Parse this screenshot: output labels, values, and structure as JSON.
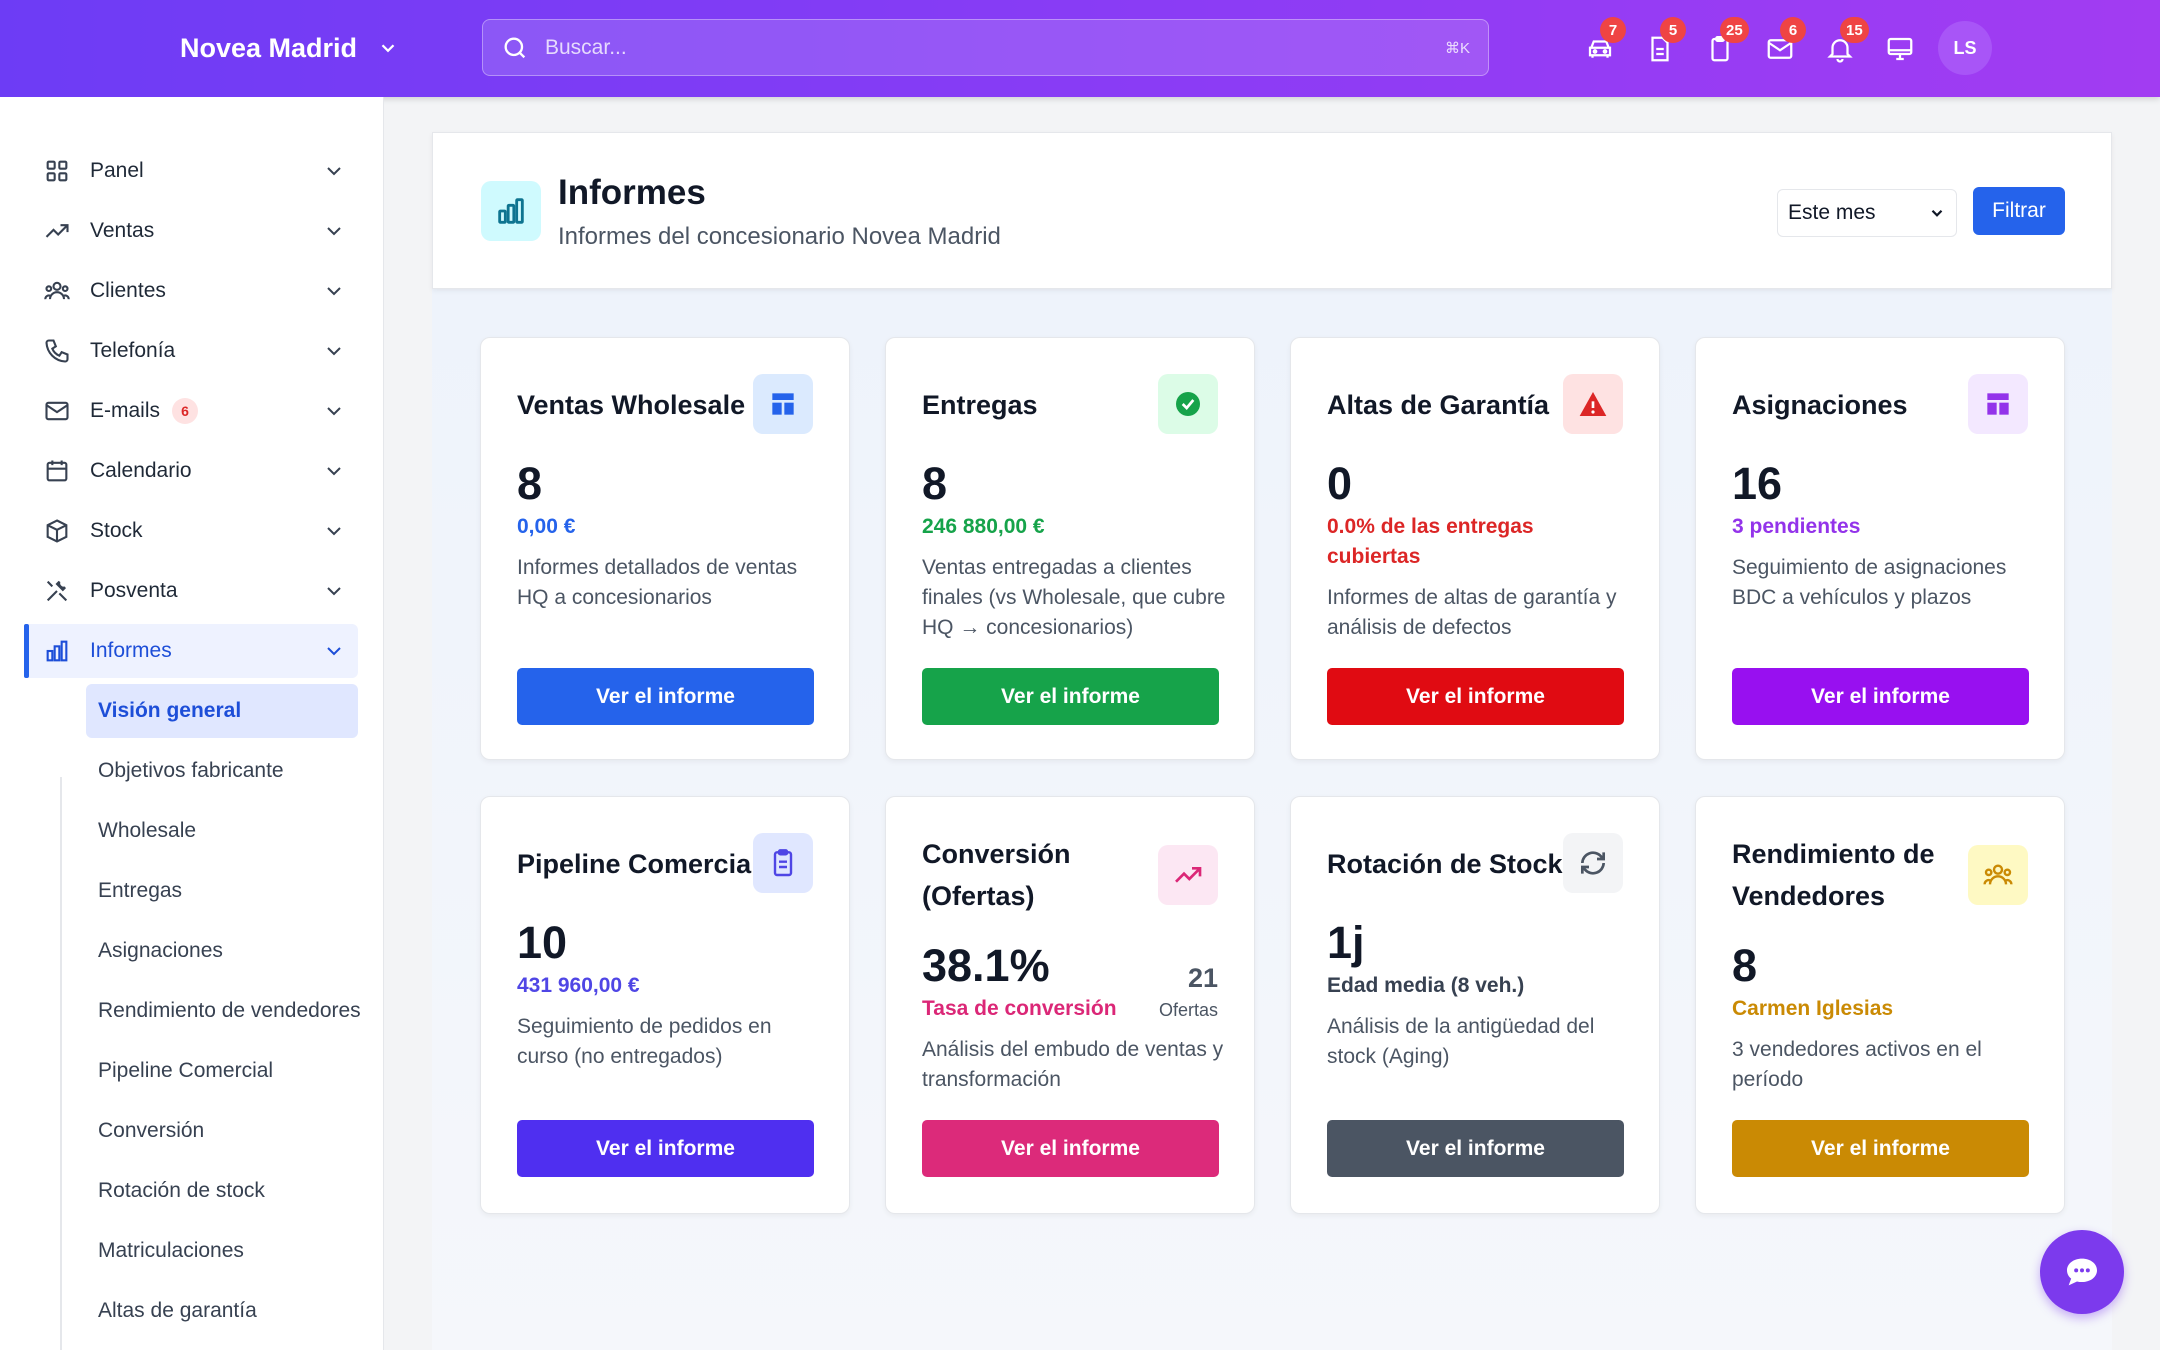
{
  "topbar": {
    "brand": "Novea Madrid",
    "search_placeholder": "Buscar...",
    "search_shortcut": "⌘K",
    "icons": [
      {
        "name": "car-icon",
        "count": "7"
      },
      {
        "name": "document-icon",
        "count": "5"
      },
      {
        "name": "clipboard-icon",
        "count": "25"
      },
      {
        "name": "mail-icon",
        "count": "6"
      },
      {
        "name": "bell-icon",
        "count": "15"
      },
      {
        "name": "monitor-icon",
        "count": ""
      }
    ],
    "avatar": "LS"
  },
  "sidebar": {
    "items": [
      {
        "label": "Panel",
        "icon": "grid-icon"
      },
      {
        "label": "Ventas",
        "icon": "trend-up-icon"
      },
      {
        "label": "Clientes",
        "icon": "users-icon"
      },
      {
        "label": "Telefonía",
        "icon": "phone-icon"
      },
      {
        "label": "E-mails",
        "icon": "mail-icon",
        "badge": "6"
      },
      {
        "label": "Calendario",
        "icon": "calendar-icon"
      },
      {
        "label": "Stock",
        "icon": "box-icon"
      },
      {
        "label": "Posventa",
        "icon": "tools-icon"
      },
      {
        "label": "Informes",
        "icon": "bar-chart-icon",
        "active": true
      }
    ],
    "subitems": [
      {
        "label": "Visión general",
        "active": true
      },
      {
        "label": "Objetivos fabricante"
      },
      {
        "label": "Wholesale"
      },
      {
        "label": "Entregas"
      },
      {
        "label": "Asignaciones"
      },
      {
        "label": "Rendimiento de vendedores"
      },
      {
        "label": "Pipeline Comercial"
      },
      {
        "label": "Conversión"
      },
      {
        "label": "Rotación de stock"
      },
      {
        "label": "Matriculaciones"
      },
      {
        "label": "Altas de garantía"
      }
    ]
  },
  "header": {
    "title": "Informes",
    "subtitle": "Informes del concesionario Novea Madrid",
    "period": "Este mes",
    "filter_label": "Filtrar"
  },
  "cards": [
    {
      "title": "Ventas Wholesale",
      "icon": "layout-icon",
      "value": "8",
      "sub": "0,00 €",
      "sub_color": "#2563eb",
      "desc": "Informes detallados de ventas HQ a concesionarios",
      "button": "Ver el informe",
      "color": "#2563eb",
      "icon_bg": "#dbeafe"
    },
    {
      "title": "Entregas",
      "icon": "check-circle-icon",
      "value": "8",
      "sub": "246 880,00 €",
      "sub_color": "#16a34a",
      "desc": "Ventas entregadas a clientes finales (vs Wholesale, que cubre HQ → concesionarios)",
      "button": "Ver el informe",
      "color": "#16a34a",
      "icon_bg": "#dcfce7"
    },
    {
      "title": "Altas de Garantía",
      "icon": "warning-icon",
      "value": "0",
      "sub": "0.0% de las entregas cubiertas",
      "sub_color": "#dc2626",
      "desc": "Informes de altas de garantía y análisis de defectos",
      "button": "Ver el informe",
      "color": "#e00b12",
      "icon_bg": "#fee2e2"
    },
    {
      "title": "Asignaciones",
      "icon": "layout-icon",
      "value": "16",
      "sub": "3 pendientes",
      "sub_color": "#9333ea",
      "desc": "Seguimiento de asignaciones BDC a vehículos y plazos",
      "button": "Ver el informe",
      "color": "#9810f0",
      "icon_bg": "#f3e8ff"
    },
    {
      "title": "Pipeline Comercial",
      "icon": "clipboard-list-icon",
      "value": "10",
      "sub": "431 960,00 €",
      "sub_color": "#4f46e5",
      "desc": "Seguimiento de pedidos en curso (no entregados)",
      "button": "Ver el informe",
      "color": "#4f2ff0",
      "icon_bg": "#e0e7ff"
    },
    {
      "title": "Conversión (Ofertas)",
      "icon": "trend-up-icon",
      "value": "38.1%",
      "sub": "Tasa de conversión",
      "sub_color": "#db2777",
      "side_value": "21",
      "side_label": "Ofertas",
      "desc": "Análisis del embudo de ventas y transformación",
      "button": "Ver el informe",
      "color": "#dc2a7a",
      "icon_bg": "#fce7f3"
    },
    {
      "title": "Rotación de Stock",
      "icon": "refresh-icon",
      "value": "1j",
      "sub": "Edad media (8 veh.)",
      "sub_color": "#374151",
      "desc": "Análisis de la antigüedad del stock (Aging)",
      "button": "Ver el informe",
      "color": "#4b5563",
      "icon_bg": "#f3f4f6"
    },
    {
      "title": "Rendimiento de Vendedores",
      "icon": "users-icon",
      "value": "8",
      "sub": "Carmen Iglesias",
      "sub_color": "#ca8a04",
      "desc": "3 vendedores activos en el período",
      "button": "Ver el informe",
      "color": "#ca8a04",
      "icon_bg": "#fef9c3"
    }
  ]
}
